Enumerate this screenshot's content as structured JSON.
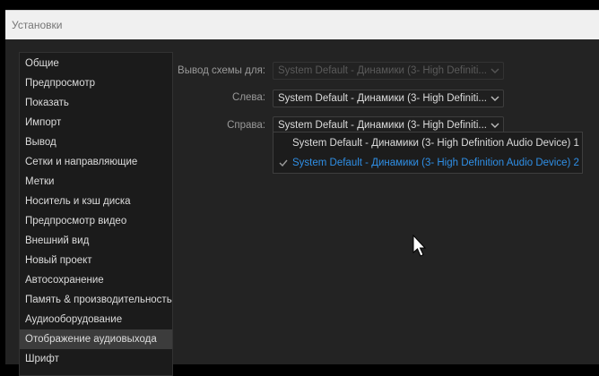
{
  "window": {
    "title": "Установки"
  },
  "sidebar": {
    "items": [
      {
        "label": "Общие"
      },
      {
        "label": "Предпросмотр"
      },
      {
        "label": "Показать"
      },
      {
        "label": "Импорт"
      },
      {
        "label": "Вывод"
      },
      {
        "label": "Сетки и направляющие"
      },
      {
        "label": "Метки"
      },
      {
        "label": "Носитель и кэш диска"
      },
      {
        "label": "Предпросмотр видео"
      },
      {
        "label": "Внешний вид"
      },
      {
        "label": "Новый проект"
      },
      {
        "label": "Автосохранение"
      },
      {
        "label": "Память & производительность"
      },
      {
        "label": "Аудиооборудование"
      },
      {
        "label": "Отображение аудиовыхода"
      },
      {
        "label": "Шрифт"
      }
    ],
    "selected_index": 14
  },
  "settings": {
    "output_scheme": {
      "label": "Вывод схемы для:",
      "value": "System Default - Динамики (3- High Definiti..."
    },
    "left": {
      "label": "Слева:",
      "value": "System Default - Динамики (3- High Definiti..."
    },
    "right": {
      "label": "Справа:",
      "value": "System Default - Динамики (3- High Definiti..."
    }
  },
  "dropdown": {
    "options": [
      {
        "label": "System Default - Динамики (3- High Definition Audio Device) 1",
        "checked": false
      },
      {
        "label": "System Default - Динамики (3- High Definition Audio Device) 2",
        "checked": true
      }
    ]
  },
  "colors": {
    "accent": "#2f8fe6",
    "background": "#232323",
    "text": "#dcdcdc"
  },
  "icons": {
    "chevron": "chevron-down-icon",
    "check": "check-icon",
    "cursor": "mouse-pointer-icon"
  }
}
